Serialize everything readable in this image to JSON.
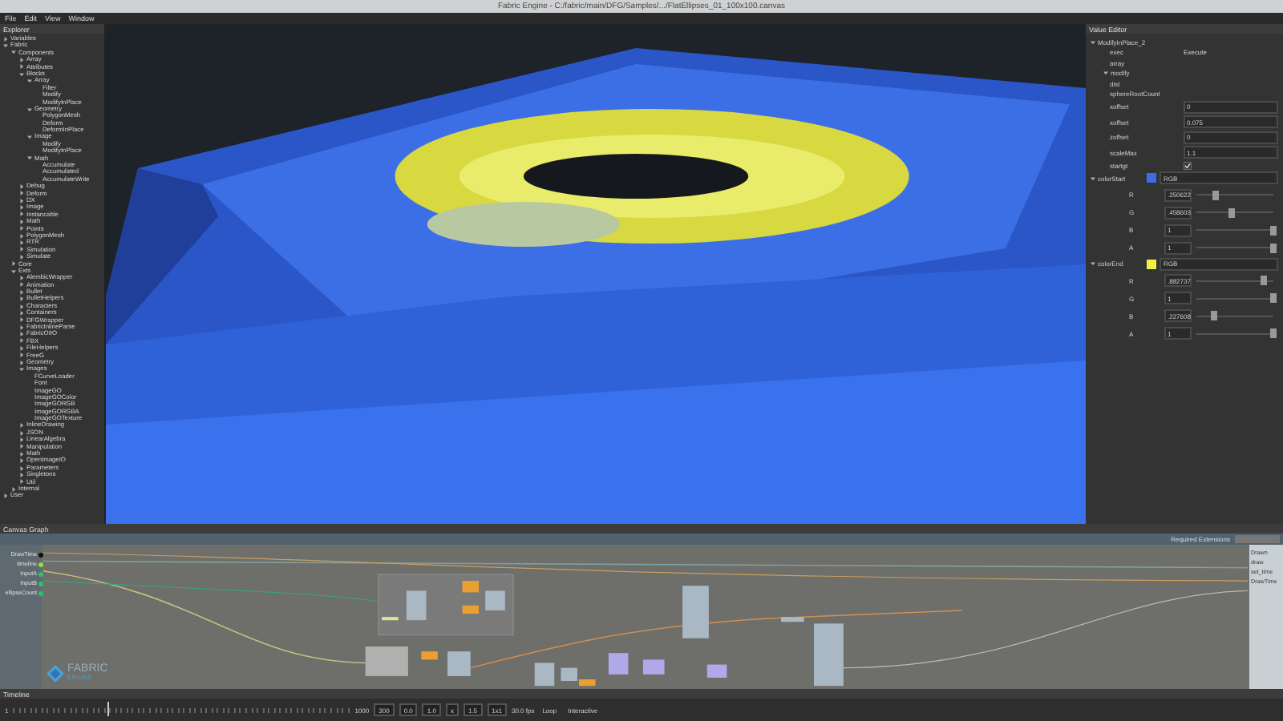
{
  "window": {
    "title": "Fabric Engine - C:/fabric/main/DFG/Samples/.../FlatEllipses_01_100x100.canvas"
  },
  "menu": [
    "File",
    "Edit",
    "View",
    "Window"
  ],
  "explorer": {
    "title": "Explorer",
    "items": [
      {
        "label": "Variables",
        "expanded": false
      },
      {
        "label": "Fabric",
        "expanded": true,
        "children": [
          {
            "label": "Components",
            "expanded": true,
            "children": [
              {
                "label": "Array",
                "expanded": false
              },
              {
                "label": "Attributes",
                "expanded": false
              },
              {
                "label": "Blocks",
                "expanded": true,
                "children": [
                  {
                    "label": "Array",
                    "expanded": true,
                    "children": [
                      {
                        "label": "Filter"
                      },
                      {
                        "label": "Modify"
                      },
                      {
                        "label": "ModifyInPlace"
                      }
                    ]
                  },
                  {
                    "label": "Geometry",
                    "expanded": true,
                    "children": [
                      {
                        "label": "PolygonMesh"
                      },
                      {
                        "label": "Deform"
                      },
                      {
                        "label": "DeformInPlace"
                      }
                    ]
                  },
                  {
                    "label": "Image",
                    "expanded": true,
                    "children": [
                      {
                        "label": "Modify"
                      },
                      {
                        "label": "ModifyInPlace"
                      }
                    ]
                  },
                  {
                    "label": "Math",
                    "expanded": true,
                    "children": [
                      {
                        "label": "Accumulate"
                      },
                      {
                        "label": "Accumulated"
                      },
                      {
                        "label": "AccumulateWrite"
                      }
                    ]
                  }
                ]
              },
              {
                "label": "Debug",
                "expanded": false
              },
              {
                "label": "Deform",
                "expanded": false
              },
              {
                "label": "DX",
                "expanded": false
              },
              {
                "label": "Image",
                "expanded": false
              },
              {
                "label": "Instancable",
                "expanded": false
              },
              {
                "label": "Math",
                "expanded": false
              },
              {
                "label": "Points",
                "expanded": false
              },
              {
                "label": "PolygonMesh",
                "expanded": false
              },
              {
                "label": "RTR",
                "expanded": false
              },
              {
                "label": "Simulation",
                "expanded": false
              },
              {
                "label": "Simulate",
                "expanded": false
              }
            ]
          },
          {
            "label": "Core",
            "expanded": false
          },
          {
            "label": "Exts",
            "expanded": true,
            "children": [
              {
                "label": "AlembicWrapper",
                "expanded": false
              },
              {
                "label": "Animation",
                "expanded": false
              },
              {
                "label": "Bullet",
                "expanded": false
              },
              {
                "label": "BulletHelpers",
                "expanded": false
              },
              {
                "label": "Characters",
                "expanded": false
              },
              {
                "label": "Containers",
                "expanded": false
              },
              {
                "label": "DFGWrapper",
                "expanded": false
              },
              {
                "label": "FabricInlineParse",
                "expanded": false
              },
              {
                "label": "FabricOIIO",
                "expanded": false
              },
              {
                "label": "FBX",
                "expanded": false
              },
              {
                "label": "FileHelpers",
                "expanded": false
              },
              {
                "label": "FreeG",
                "expanded": false
              },
              {
                "label": "Geometry",
                "expanded": false
              },
              {
                "label": "Images",
                "expanded": true,
                "children": [
                  {
                    "label": "FCurveLoader"
                  },
                  {
                    "label": "Font"
                  },
                  {
                    "label": "ImageGO"
                  },
                  {
                    "label": "ImageGOColor"
                  },
                  {
                    "label": "ImageGORGB"
                  },
                  {
                    "label": "ImageGORGBA"
                  },
                  {
                    "label": "ImageGOTexture"
                  }
                ]
              },
              {
                "label": "InlineDrawing",
                "expanded": false
              },
              {
                "label": "JSON",
                "expanded": false
              },
              {
                "label": "LinearAlgebra",
                "expanded": false
              },
              {
                "label": "Manipulation",
                "expanded": false
              },
              {
                "label": "Math",
                "expanded": false
              },
              {
                "label": "OpenImageIO",
                "expanded": false
              },
              {
                "label": "Parameters",
                "expanded": false
              },
              {
                "label": "Singletons",
                "expanded": false
              },
              {
                "label": "Util",
                "expanded": false
              }
            ]
          },
          {
            "label": "Internal",
            "expanded": false
          }
        ]
      },
      {
        "label": "User",
        "expanded": false
      }
    ]
  },
  "value_editor": {
    "title": "Value Editor",
    "rows": [
      {
        "kind": "group",
        "label": "ModifyInPlace_2",
        "expanded": true
      },
      {
        "kind": "text",
        "label": "exec",
        "value": "Execute"
      },
      {
        "kind": "text",
        "label": "array"
      },
      {
        "kind": "subgroup",
        "label": "modify",
        "expanded": true
      },
      {
        "kind": "text",
        "label": "dist"
      },
      {
        "kind": "text",
        "label": "sphereRootCount"
      },
      {
        "kind": "number",
        "label": "xoffset",
        "value": "0"
      },
      {
        "kind": "number",
        "label": "xoffset",
        "value": "0.075"
      },
      {
        "kind": "number",
        "label": "zoffset",
        "value": "0"
      },
      {
        "kind": "number",
        "label": "scaleMax",
        "value": "1.1"
      },
      {
        "kind": "check",
        "label": "startgt",
        "checked": true
      },
      {
        "kind": "color",
        "label": "colorStart",
        "color": "#3a6ee8",
        "value": "RGB",
        "expanded": true
      },
      {
        "kind": "slider",
        "label": "R",
        "value": ".250622",
        "level": 0.25
      },
      {
        "kind": "slider",
        "label": "G",
        "value": ".458603",
        "level": 0.46
      },
      {
        "kind": "slider",
        "label": "B",
        "value": "1",
        "level": 1
      },
      {
        "kind": "slider",
        "label": "A",
        "value": "1",
        "level": 1
      },
      {
        "kind": "color",
        "label": "colorEnd",
        "color": "#f0f040",
        "value": "RGB",
        "expanded": true
      },
      {
        "kind": "slider",
        "label": "R",
        "value": ".882737",
        "level": 0.88
      },
      {
        "kind": "slider",
        "label": "G",
        "value": "1",
        "level": 1
      },
      {
        "kind": "slider",
        "label": "B",
        "value": ".227608",
        "level": 0.23
      },
      {
        "kind": "slider",
        "label": "A",
        "value": "1",
        "level": 1
      }
    ]
  },
  "canvas_graph": {
    "title": "Canvas Graph",
    "required_label": "Required Extensions",
    "inputs": [
      {
        "label": "DrawTime",
        "color": "#101010"
      },
      {
        "label": "timeline",
        "color": "#8fe040"
      },
      {
        "label": "InputA",
        "color": "#2ec070"
      },
      {
        "label": "InputB",
        "color": "#2ec070"
      },
      {
        "label": "ellipseCount",
        "color": "#2ec070"
      }
    ],
    "outputs": [
      {
        "label": "Drawn"
      },
      {
        "label": "draw"
      },
      {
        "label": "set_time"
      },
      {
        "label": "DrawTime"
      }
    ],
    "logo": {
      "line_1": "FABRIC",
      "line_2": "ENGINE"
    }
  },
  "timeline": {
    "title": "Timeline",
    "start": "1",
    "end": "1000",
    "fields": [
      "300",
      "0.0",
      "1.0",
      "x",
      "1.5",
      "1x1"
    ],
    "fps": "30.0 fps",
    "loop": "Loop",
    "mode": "Interactive",
    "level": 0.28
  }
}
